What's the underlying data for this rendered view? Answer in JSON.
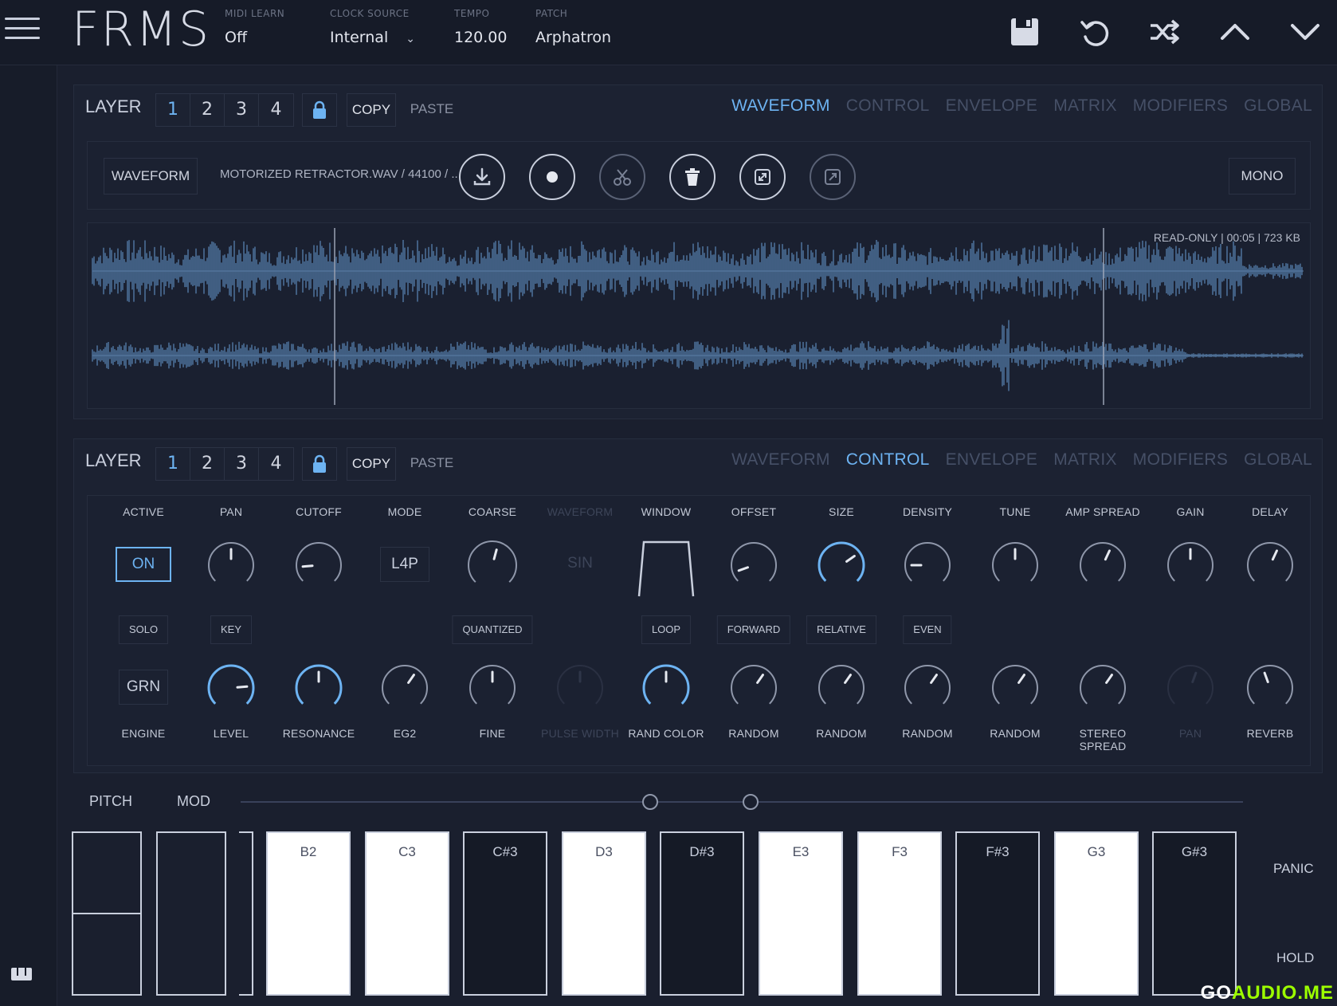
{
  "header": {
    "app_title": "FRMS",
    "midi_learn": {
      "label": "MIDI LEARN",
      "value": "Off"
    },
    "clock_source": {
      "label": "CLOCK SOURCE",
      "value": "Internal"
    },
    "tempo": {
      "label": "TEMPO",
      "value": "120.00"
    },
    "patch": {
      "label": "PATCH",
      "value": "Arphatron"
    },
    "icons": [
      "save-icon",
      "undo-icon",
      "shuffle-icon",
      "chevron-up-icon",
      "chevron-down-icon"
    ]
  },
  "layer_top": {
    "label": "LAYER",
    "numbers": [
      "1",
      "2",
      "3",
      "4"
    ],
    "active_number": "1",
    "copy": "COPY",
    "paste": "PASTE",
    "tabs": [
      "WAVEFORM",
      "CONTROL",
      "ENVELOPE",
      "MATRIX",
      "MODIFIERS",
      "GLOBAL"
    ],
    "active_tab": "WAVEFORM"
  },
  "waveform": {
    "button": "WAVEFORM",
    "file": "MOTORIZED RETRACTOR.WAV / 44100 / ...",
    "tools": [
      "download-icon",
      "record-icon",
      "scissors-icon",
      "trash-icon",
      "expand-icon",
      "open-icon"
    ],
    "mono": "MONO",
    "info": "READ-ONLY  |  00:05  |  723 KB"
  },
  "layer_bottom": {
    "label": "LAYER",
    "numbers": [
      "1",
      "2",
      "3",
      "4"
    ],
    "active_number": "1",
    "copy": "COPY",
    "paste": "PASTE",
    "tabs": [
      "WAVEFORM",
      "CONTROL",
      "ENVELOPE",
      "MATRIX",
      "MODIFIERS",
      "GLOBAL"
    ],
    "active_tab": "CONTROL"
  },
  "controls": {
    "top_labels": [
      "ACTIVE",
      "PAN",
      "CUTOFF",
      "MODE",
      "COARSE",
      "WAVEFORM",
      "WINDOW",
      "OFFSET",
      "SIZE",
      "DENSITY",
      "TUNE",
      "AMP SPREAD",
      "GAIN",
      "DELAY"
    ],
    "active_value": "ON",
    "mode_value": "L4P",
    "waveform_value": "SIN",
    "mid_buttons": {
      "solo": "SOLO",
      "key": "KEY",
      "quantized": "QUANTIZED",
      "loop": "LOOP",
      "forward": "FORWARD",
      "relative": "RELATIVE",
      "even": "EVEN"
    },
    "engine_value": "GRN",
    "bottom_labels": [
      "ENGINE",
      "LEVEL",
      "RESONANCE",
      "EG2",
      "FINE",
      "PULSE WIDTH",
      "RAND COLOR",
      "RANDOM",
      "RANDOM",
      "RANDOM",
      "RANDOM",
      "STEREO SPREAD",
      "PAN",
      "REVERB"
    ]
  },
  "keyboard": {
    "pitch": "PITCH",
    "mod": "MOD",
    "keys": [
      {
        "note": "B2",
        "color": "white"
      },
      {
        "note": "C3",
        "color": "white"
      },
      {
        "note": "C#3",
        "color": "black"
      },
      {
        "note": "D3",
        "color": "white"
      },
      {
        "note": "D#3",
        "color": "black"
      },
      {
        "note": "E3",
        "color": "white"
      },
      {
        "note": "F3",
        "color": "white"
      },
      {
        "note": "F#3",
        "color": "black"
      },
      {
        "note": "G3",
        "color": "white"
      },
      {
        "note": "G#3",
        "color": "black"
      }
    ],
    "panic": "PANIC",
    "hold": "HOLD"
  },
  "watermark": {
    "prefix": "GO",
    "suffix": "AUDIO.ME"
  },
  "colors": {
    "accent": "#6db3f2",
    "background": "#1a1f2e",
    "panel": "#1c2232"
  }
}
